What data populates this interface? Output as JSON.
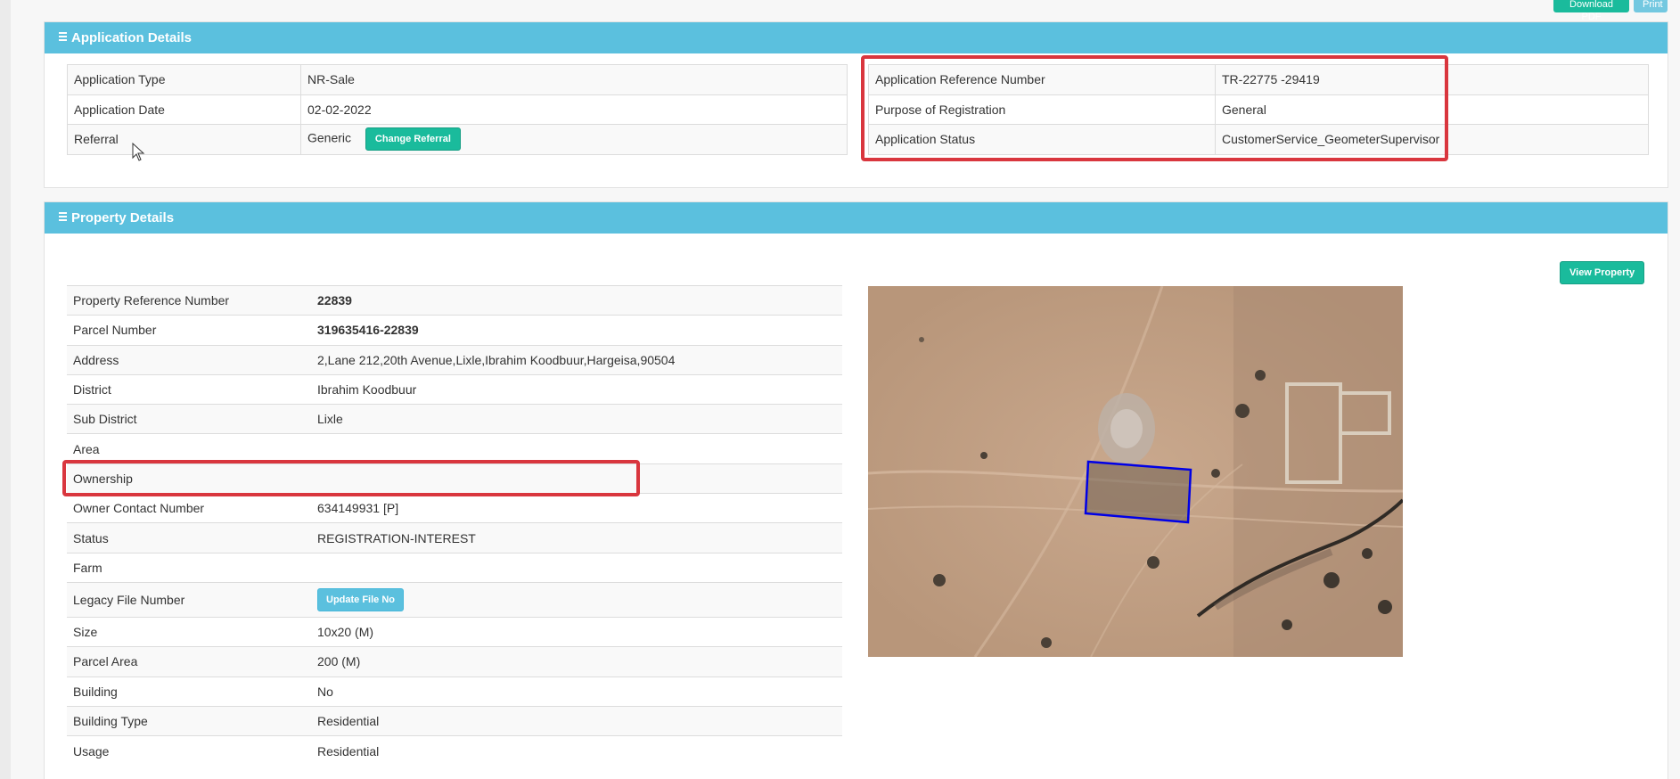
{
  "toolbar": {
    "download_pdf": "Download PDF",
    "print": "Print"
  },
  "application": {
    "title": "Application Details",
    "left_rows": [
      {
        "label": "Application Type",
        "value": "NR-Sale"
      },
      {
        "label": "Application Date",
        "value": "02-02-2022"
      },
      {
        "label": "Referral",
        "value": "Generic",
        "button": "Change Referral"
      }
    ],
    "right_rows": [
      {
        "label": "Application Reference Number",
        "value": "TR-22775 -29419"
      },
      {
        "label": "Purpose of Registration",
        "value": "General"
      },
      {
        "label": "Application Status",
        "value": "CustomerService_GeometerSupervisor"
      }
    ]
  },
  "property": {
    "title": "Property Details",
    "view_button": "View Property",
    "rows": [
      {
        "label": "Property Reference Number",
        "value": "22839"
      },
      {
        "label": "Parcel Number",
        "value": "319635416-22839"
      },
      {
        "label": "Address",
        "value": "2,Lane 212,20th Avenue,Lixle,Ibrahim Koodbuur,Hargeisa,90504"
      },
      {
        "label": "District",
        "value": "Ibrahim Koodbuur"
      },
      {
        "label": "Sub District",
        "value": "Lixle"
      },
      {
        "label": "Area",
        "value": ""
      },
      {
        "label": "Ownership",
        "value": ""
      },
      {
        "label": "Owner Contact Number",
        "value": "634149931 [P]"
      },
      {
        "label": "Status",
        "value": "REGISTRATION-INTEREST"
      },
      {
        "label": "Farm",
        "value": ""
      },
      {
        "label": "Legacy File Number",
        "value": "",
        "button": "Update File No"
      },
      {
        "label": "Size",
        "value": "10x20 (M)"
      },
      {
        "label": "Parcel Area",
        "value": "200 (M)"
      },
      {
        "label": "Building",
        "value": "No"
      },
      {
        "label": "Building Type",
        "value": "Residential"
      },
      {
        "label": "Usage",
        "value": "Residential"
      }
    ]
  },
  "colors": {
    "header": "#5bc0de",
    "green_button": "#1abb9c",
    "highlight": "#d9363e",
    "parcel_outline": "#0000e6"
  }
}
